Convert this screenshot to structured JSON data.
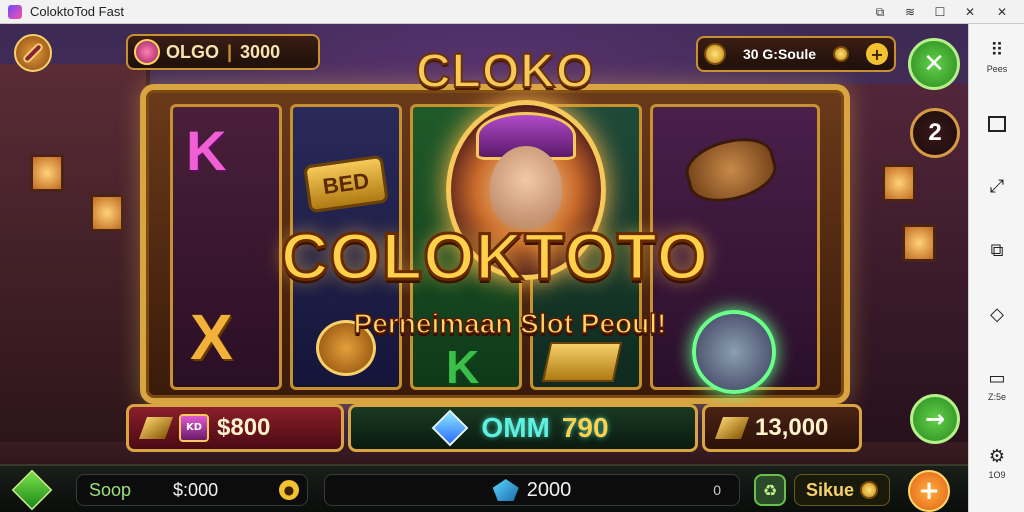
{
  "window": {
    "title": "ColoktoTod Fast",
    "controls": [
      "picture-in-picture-icon",
      "wifi-icon",
      "maximize-icon",
      "close-icon"
    ]
  },
  "hud": {
    "currency_label": "OLGO",
    "currency_value": "3000",
    "top_right_value": "30 G:Soule",
    "level_badge": "2"
  },
  "slot": {
    "top_logo": "CLOKO",
    "title": "COLOKTOTO",
    "subtitle": "Perneimaan Slot Peoul!",
    "symbols": [
      "K",
      "K",
      "X",
      "K"
    ],
    "bar_label": "BED"
  },
  "bet_row": {
    "left_value": "$800",
    "left_badge": "KD",
    "center_label": "OMM",
    "center_value": "790",
    "right_value": "13,000"
  },
  "bottom_bar": {
    "left_label": "Soop",
    "left_value": "$:000",
    "center_value": "2000",
    "center_suffix": "0",
    "right_label": "Sikue",
    "add_label": "+"
  },
  "sidebar": {
    "items": [
      {
        "label": "Pees",
        "icon": "grid-dots-icon"
      },
      {
        "label": "",
        "icon": "window-icon"
      },
      {
        "label": "",
        "icon": "resize-icon"
      },
      {
        "label": "",
        "icon": "layers-icon"
      },
      {
        "label": "",
        "icon": "diamond-icon"
      },
      {
        "label": "Z:5e",
        "icon": "screen-icon"
      },
      {
        "label": "1O9",
        "icon": "settings-icon"
      }
    ]
  },
  "colors": {
    "accent_gold": "#d9a442",
    "green": "#2a8a1e",
    "orange": "#e0601a"
  }
}
